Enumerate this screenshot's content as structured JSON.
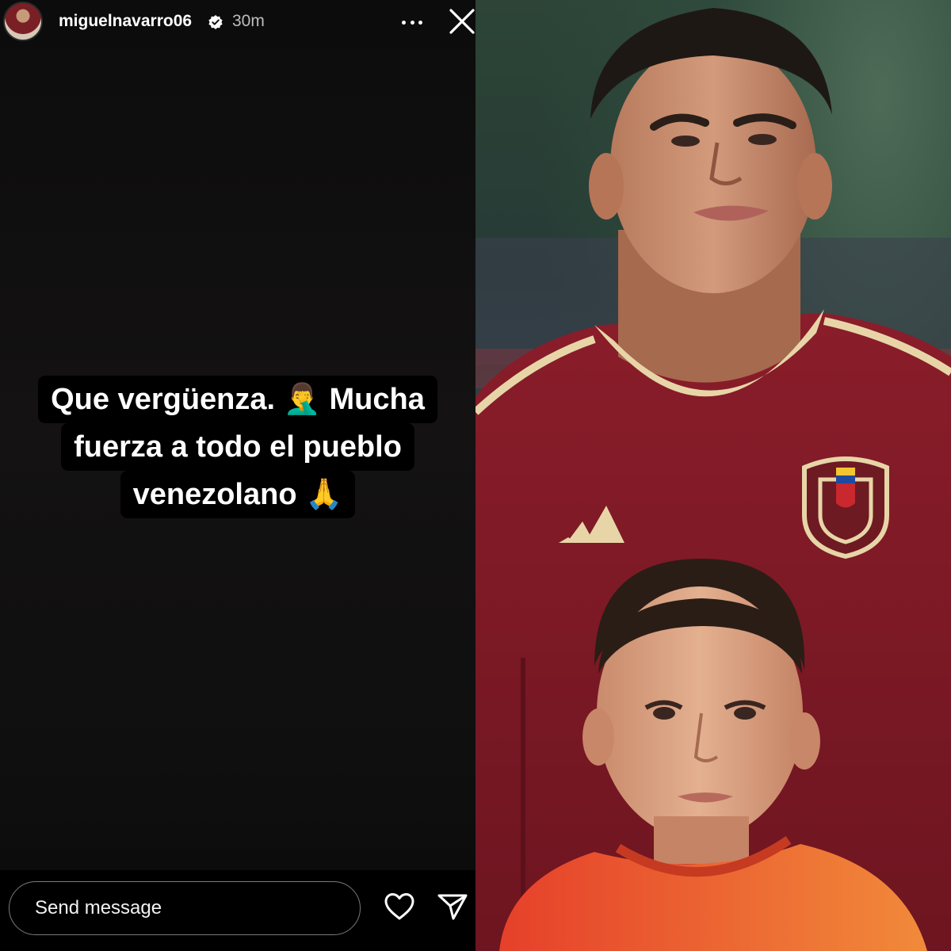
{
  "story": {
    "username": "miguelnavarro06",
    "time_ago": "30m",
    "caption_lines": [
      "Que vergüenza. 🤦‍♂️ Mucha",
      "fuerza a todo el pueblo",
      "venezolano 🙏"
    ],
    "message_placeholder": "Send message",
    "icons": {
      "verified": "verified-badge-icon",
      "more": "more-options-icon",
      "close": "close-icon",
      "like": "heart-icon",
      "share": "send-icon"
    }
  },
  "colors": {
    "jersey": "#7e1a25",
    "jersey_trim": "#e7d5a8",
    "child_shirt": "#e8552a"
  }
}
